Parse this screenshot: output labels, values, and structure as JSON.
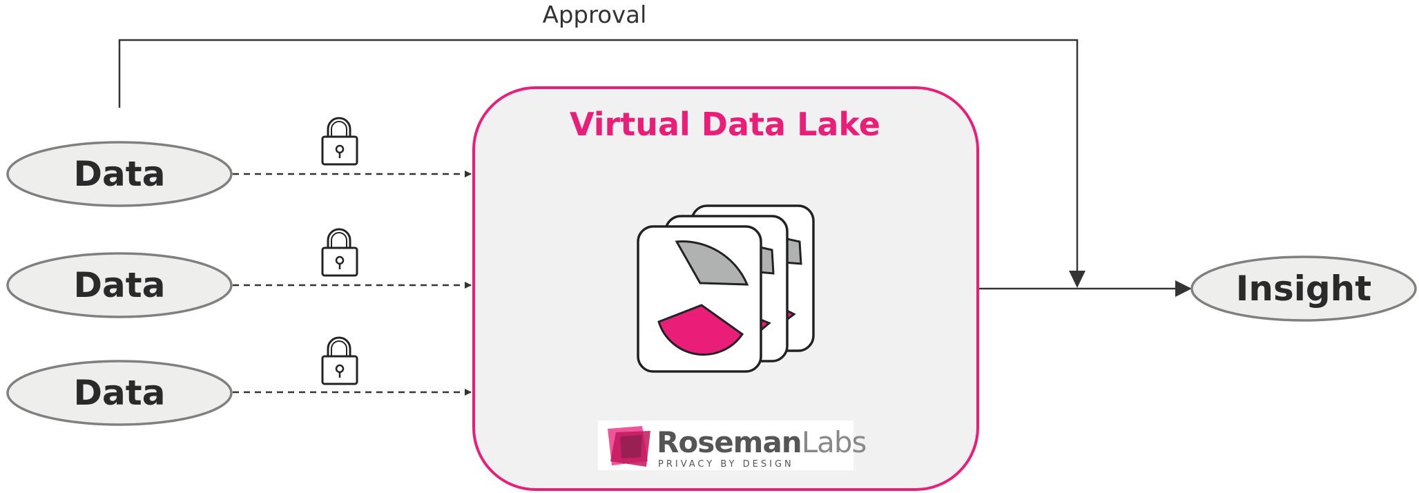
{
  "approval_label": "Approval",
  "data_sources": [
    {
      "label": "Data"
    },
    {
      "label": "Data"
    },
    {
      "label": "Data"
    }
  ],
  "lake": {
    "title": "Virtual Data Lake"
  },
  "insight_label": "Insight",
  "logo": {
    "name_bold": "Roseman",
    "name_light": "Labs",
    "tagline": "PRIVACY BY DESIGN"
  },
  "colors": {
    "accent": "#e91e78",
    "lake_fill": "#f0f1f0",
    "node_fill": "#eeeeec",
    "node_stroke": "#808080",
    "line": "#333333",
    "chart_gray": "#b0b2b1"
  },
  "icons": [
    "lock-icon",
    "document-stack-icon"
  ]
}
